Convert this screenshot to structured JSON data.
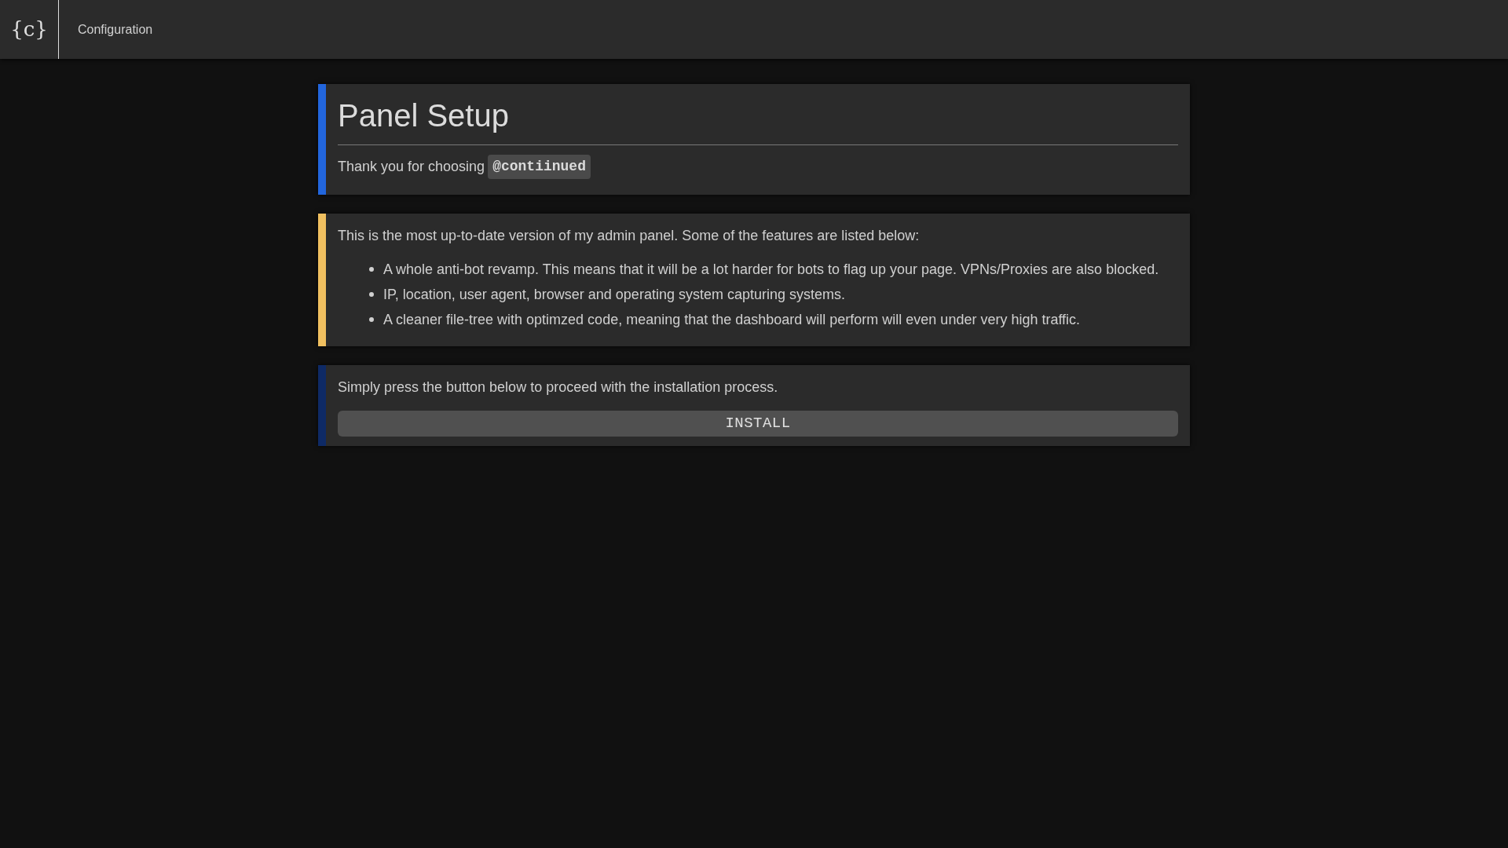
{
  "header": {
    "logo": "{c}",
    "title": "Configuration"
  },
  "cards": [
    {
      "kind": "heading",
      "color": "#2266dd",
      "title": "Panel Setup",
      "text": "Thank you for choosing",
      "code": "@contiinued"
    },
    {
      "kind": "list",
      "color": "#f0c060",
      "intro": "This is the most up-to-date version of my admin panel. Some of the features are listed below:",
      "items": [
        "A whole anti-bot revamp. This means that it will be a lot harder for bots to flag up your page. VPNs/Proxies are also blocked.",
        "IP, location, user agent, browser and operating system capturing systems.",
        "A cleaner file-tree with optimzed code, meaning that the dashboard will perform will even under very high traffic."
      ]
    },
    {
      "kind": "action",
      "color": "#0e2a66",
      "text": "Simply press the button below to proceed with the installation process.",
      "button": "INSTALL"
    }
  ]
}
